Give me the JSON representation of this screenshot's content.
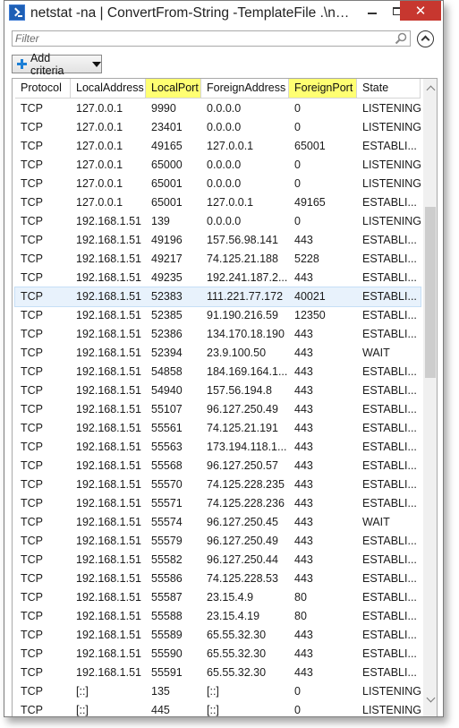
{
  "window": {
    "title": "netstat -na | ConvertFrom-String -TemplateFile .\\netstat.template | Out-GridView",
    "minimize_label": "",
    "maximize_label": "",
    "close_label": "✕"
  },
  "filter": {
    "placeholder": "Filter"
  },
  "toolbar": {
    "add_criteria_label": "Add criteria"
  },
  "columns": [
    {
      "label": "Protocol",
      "sorted": false
    },
    {
      "label": "LocalAddress",
      "sorted": false
    },
    {
      "label": "LocalPort",
      "sorted": true
    },
    {
      "label": "ForeignAddress",
      "sorted": false
    },
    {
      "label": "ForeignPort",
      "sorted": true
    },
    {
      "label": "State",
      "sorted": false
    }
  ],
  "colors": {
    "highlight_header": "#ffff72",
    "selected_row": "#e8f2fc",
    "close_button": "#c7372f"
  },
  "rows": [
    [
      "TCP",
      "127.0.0.1",
      "9990",
      "0.0.0.0",
      "0",
      "LISTENING"
    ],
    [
      "TCP",
      "127.0.0.1",
      "23401",
      "0.0.0.0",
      "0",
      "LISTENING"
    ],
    [
      "TCP",
      "127.0.0.1",
      "49165",
      "127.0.0.1",
      "65001",
      "ESTABLI..."
    ],
    [
      "TCP",
      "127.0.0.1",
      "65000",
      "0.0.0.0",
      "0",
      "LISTENING"
    ],
    [
      "TCP",
      "127.0.0.1",
      "65001",
      "0.0.0.0",
      "0",
      "LISTENING"
    ],
    [
      "TCP",
      "127.0.0.1",
      "65001",
      "127.0.0.1",
      "49165",
      "ESTABLI..."
    ],
    [
      "TCP",
      "192.168.1.51",
      "139",
      "0.0.0.0",
      "0",
      "LISTENING"
    ],
    [
      "TCP",
      "192.168.1.51",
      "49196",
      "157.56.98.141",
      "443",
      "ESTABLI..."
    ],
    [
      "TCP",
      "192.168.1.51",
      "49217",
      "74.125.21.188",
      "5228",
      "ESTABLI..."
    ],
    [
      "TCP",
      "192.168.1.51",
      "49235",
      "192.241.187.2...",
      "443",
      "ESTABLI..."
    ],
    [
      "TCP",
      "192.168.1.51",
      "52383",
      "111.221.77.172",
      "40021",
      "ESTABLI..."
    ],
    [
      "TCP",
      "192.168.1.51",
      "52385",
      "91.190.216.59",
      "12350",
      "ESTABLI..."
    ],
    [
      "TCP",
      "192.168.1.51",
      "52386",
      "134.170.18.190",
      "443",
      "ESTABLI..."
    ],
    [
      "TCP",
      "192.168.1.51",
      "52394",
      "23.9.100.50",
      "443",
      "WAIT"
    ],
    [
      "TCP",
      "192.168.1.51",
      "54858",
      "184.169.164.1...",
      "443",
      "ESTABLI..."
    ],
    [
      "TCP",
      "192.168.1.51",
      "54940",
      "157.56.194.8",
      "443",
      "ESTABLI..."
    ],
    [
      "TCP",
      "192.168.1.51",
      "55107",
      "96.127.250.49",
      "443",
      "ESTABLI..."
    ],
    [
      "TCP",
      "192.168.1.51",
      "55561",
      "74.125.21.191",
      "443",
      "ESTABLI..."
    ],
    [
      "TCP",
      "192.168.1.51",
      "55563",
      "173.194.118.1...",
      "443",
      "ESTABLI..."
    ],
    [
      "TCP",
      "192.168.1.51",
      "55568",
      "96.127.250.57",
      "443",
      "ESTABLI..."
    ],
    [
      "TCP",
      "192.168.1.51",
      "55570",
      "74.125.228.235",
      "443",
      "ESTABLI..."
    ],
    [
      "TCP",
      "192.168.1.51",
      "55571",
      "74.125.228.236",
      "443",
      "ESTABLI..."
    ],
    [
      "TCP",
      "192.168.1.51",
      "55574",
      "96.127.250.45",
      "443",
      "WAIT"
    ],
    [
      "TCP",
      "192.168.1.51",
      "55579",
      "96.127.250.49",
      "443",
      "ESTABLI..."
    ],
    [
      "TCP",
      "192.168.1.51",
      "55582",
      "96.127.250.44",
      "443",
      "ESTABLI..."
    ],
    [
      "TCP",
      "192.168.1.51",
      "55586",
      "74.125.228.53",
      "443",
      "ESTABLI..."
    ],
    [
      "TCP",
      "192.168.1.51",
      "55587",
      "23.15.4.9",
      "80",
      "ESTABLI..."
    ],
    [
      "TCP",
      "192.168.1.51",
      "55588",
      "23.15.4.19",
      "80",
      "ESTABLI..."
    ],
    [
      "TCP",
      "192.168.1.51",
      "55589",
      "65.55.32.30",
      "443",
      "ESTABLI..."
    ],
    [
      "TCP",
      "192.168.1.51",
      "55590",
      "65.55.32.30",
      "443",
      "ESTABLI..."
    ],
    [
      "TCP",
      "192.168.1.51",
      "55591",
      "65.55.32.30",
      "443",
      "ESTABLI..."
    ],
    [
      "TCP",
      "[::]",
      "135",
      "[::]",
      "0",
      "LISTENING"
    ],
    [
      "TCP",
      "[::]",
      "445",
      "[::]",
      "0",
      "LISTENING"
    ]
  ],
  "selected_row_index": 10
}
